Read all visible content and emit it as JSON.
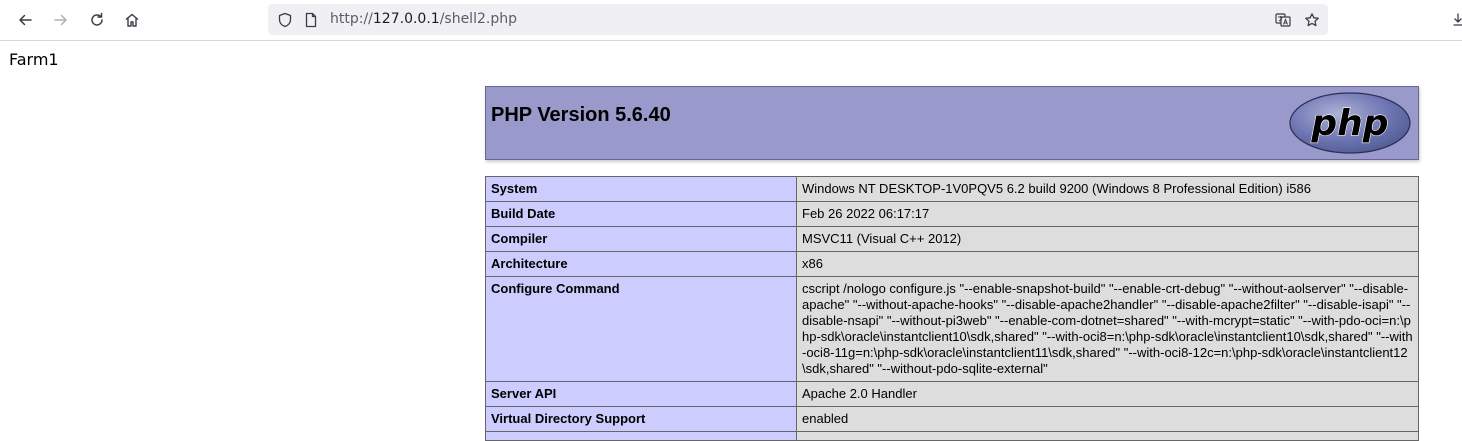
{
  "browser": {
    "url_prefix": "http://",
    "url_host": "127.0.0.1",
    "url_path": "/shell2.php"
  },
  "page": {
    "farm_label": "Farm1",
    "php_version_title": "PHP Version 5.6.40",
    "logo_text": "php",
    "info_rows": [
      {
        "key": "System",
        "value": "Windows NT DESKTOP-1V0PQV5 6.2 build 9200 (Windows 8 Professional Edition) i586"
      },
      {
        "key": "Build Date",
        "value": "Feb 26 2022 06:17:17"
      },
      {
        "key": "Compiler",
        "value": "MSVC11 (Visual C++ 2012)"
      },
      {
        "key": "Architecture",
        "value": "x86"
      },
      {
        "key": "Configure Command",
        "value": "cscript /nologo configure.js \"--enable-snapshot-build\" \"--enable-crt-debug\" \"--without-aolserver\" \"--disable-apache\" \"--without-apache-hooks\" \"--disable-apache2handler\" \"--disable-apache2filter\" \"--disable-isapi\" \"--disable-nsapi\" \"--without-pi3web\" \"--enable-com-dotnet=shared\" \"--with-mcrypt=static\" \"--with-pdo-oci=n:\\php-sdk\\oracle\\instantclient10\\sdk,shared\" \"--with-oci8=n:\\php-sdk\\oracle\\instantclient10\\sdk,shared\" \"--with-oci8-11g=n:\\php-sdk\\oracle\\instantclient11\\sdk,shared\" \"--with-oci8-12c=n:\\php-sdk\\oracle\\instantclient12\\sdk,shared\" \"--without-pdo-sqlite-external\""
      },
      {
        "key": "Server API",
        "value": "Apache 2.0 Handler"
      },
      {
        "key": "Virtual Directory Support",
        "value": "enabled"
      },
      {
        "key": "",
        "value": ""
      }
    ]
  },
  "colors": {
    "header_bg": "#9999cc",
    "key_cell_bg": "#ccccff",
    "value_cell_bg": "#dddddd"
  }
}
